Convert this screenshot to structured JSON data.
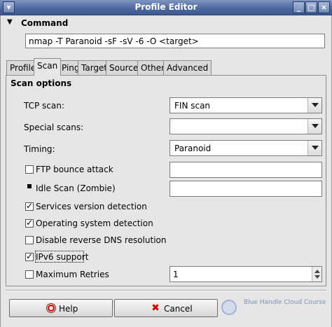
{
  "window": {
    "title": "Profile Editor"
  },
  "command": {
    "section_label": "Command",
    "value": "nmap -T Paranoid -sF -sV -6 -O <target>"
  },
  "tabs": [
    {
      "label": "Profile"
    },
    {
      "label": "Scan"
    },
    {
      "label": "Ping"
    },
    {
      "label": "Target"
    },
    {
      "label": "Source"
    },
    {
      "label": "Other"
    },
    {
      "label": "Advanced"
    }
  ],
  "scan_options": {
    "heading": "Scan options",
    "tcp_scan": {
      "label": "TCP scan:",
      "value": "FIN scan"
    },
    "special_scans": {
      "label": "Special scans:",
      "value": ""
    },
    "timing": {
      "label": "Timing:",
      "value": "Paranoid"
    },
    "ftp_bounce": {
      "label": "FTP bounce attack",
      "checked": false,
      "value": ""
    },
    "idle_scan": {
      "label": "Idle Scan (Zombie)",
      "value": ""
    },
    "services_version": {
      "label": "Services version detection",
      "checked": true
    },
    "os_detection": {
      "label": "Operating system detection",
      "checked": true
    },
    "disable_rdns": {
      "label": "Disable reverse DNS resolution",
      "checked": false
    },
    "ipv6": {
      "label": "IPv6 support",
      "checked": true
    },
    "max_retries": {
      "label": "Maximum Retries",
      "checked": false,
      "value": "1"
    }
  },
  "buttons": {
    "help": "Help",
    "cancel": "Cancel"
  },
  "watermark": {
    "text": "Blue Handle Cloud Course"
  },
  "colors": {
    "titlebar": "#4f6aa0",
    "window_bg": "#e6e6e6",
    "cancel_icon": "#d00000"
  }
}
